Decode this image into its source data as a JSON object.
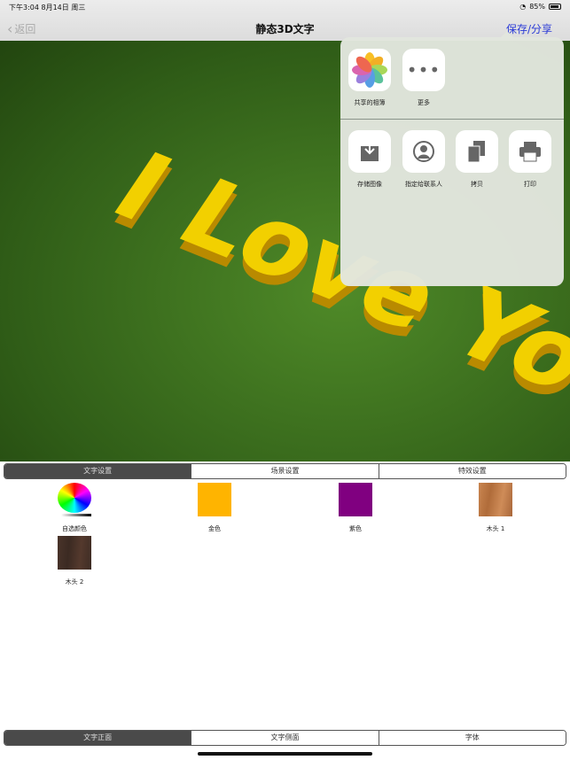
{
  "status_bar": {
    "time_date": "下午3:04  8月14日 周三",
    "battery": "85%"
  },
  "nav": {
    "back_label": "返回",
    "title": "静态3D文字",
    "save_share_label": "保存/分享"
  },
  "scene": {
    "text": "I Love You",
    "text_color": "#f2d000"
  },
  "share_sheet": {
    "row1": [
      {
        "label": "共享的相簿",
        "icon": "photos-icon"
      },
      {
        "label": "更多",
        "icon": "more-icon"
      }
    ],
    "row2": [
      {
        "label": "存储图像",
        "icon": "save-image-icon"
      },
      {
        "label": "指定给联系人",
        "icon": "contact-icon"
      },
      {
        "label": "拷贝",
        "icon": "copy-icon"
      },
      {
        "label": "打印",
        "icon": "print-icon"
      }
    ]
  },
  "top_tabs": [
    {
      "label": "文字设置",
      "active": true
    },
    {
      "label": "场景设置"
    },
    {
      "label": "特效设置"
    }
  ],
  "materials": [
    {
      "label": "自选颜色",
      "type": "color-wheel"
    },
    {
      "label": "金色",
      "color": "#ffb400"
    },
    {
      "label": "紫色",
      "color": "#800080"
    },
    {
      "label": "木头 1",
      "color": "#c07a45"
    },
    {
      "label": "木头 2",
      "color": "#4a342a"
    }
  ],
  "bottom_tabs": [
    {
      "label": "文字正面",
      "active": true
    },
    {
      "label": "文字侧面"
    },
    {
      "label": "字体"
    }
  ]
}
